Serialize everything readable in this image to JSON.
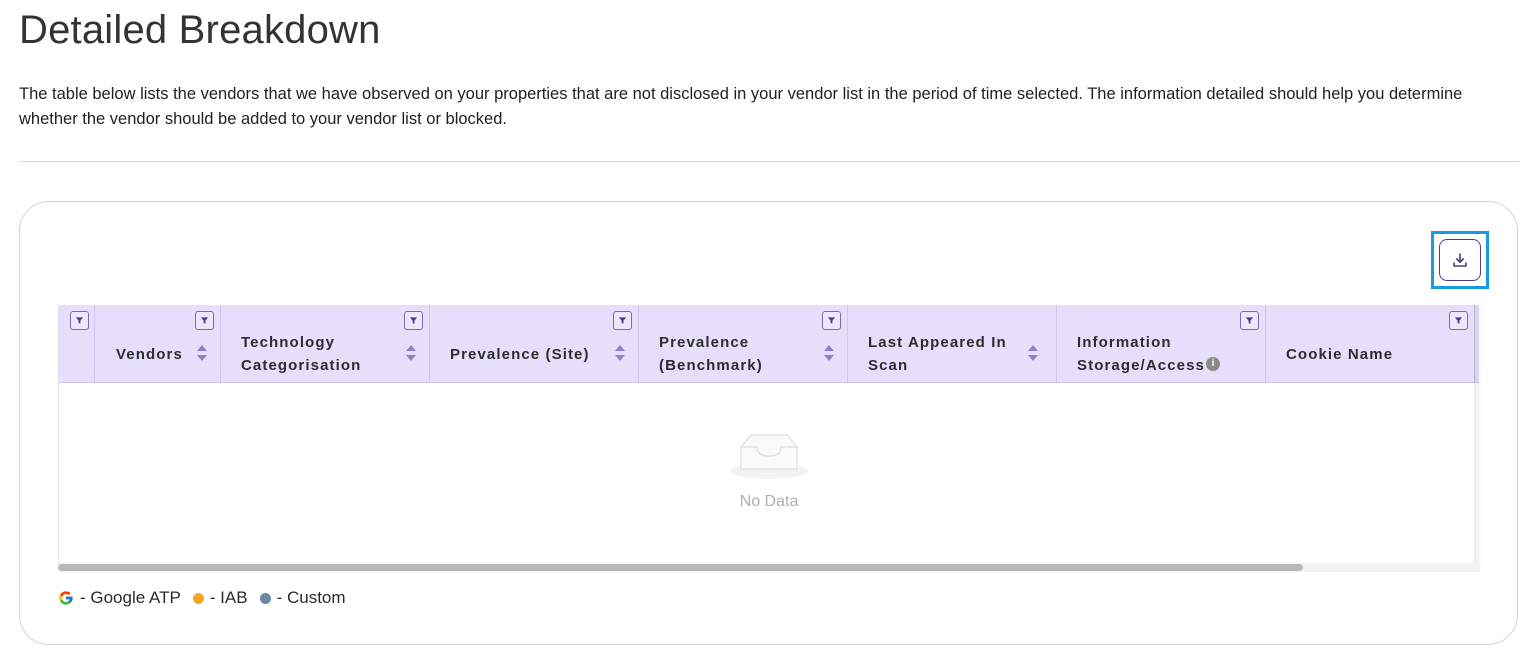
{
  "page": {
    "title": "Detailed Breakdown",
    "description": "The table below lists the vendors that we have observed on your properties that are not disclosed in your vendor list in the period of time selected. The information detailed should help you determine whether the vendor should be added to your vendor list or blocked."
  },
  "table": {
    "columns": [
      {
        "label": "Vendors"
      },
      {
        "label": "Technology Categorisation"
      },
      {
        "label": "Prevalence (Site)"
      },
      {
        "label": "Prevalence (Benchmark)"
      },
      {
        "label": "Last Appeared In Scan"
      },
      {
        "label": "Information Storage/Access"
      },
      {
        "label": "Cookie Name"
      }
    ],
    "empty_text": "No Data"
  },
  "legend": {
    "items": [
      {
        "icon": "google-icon",
        "label": "- Google ATP"
      },
      {
        "icon": "orange-dot",
        "label": "- IAB",
        "color": "#f5a623"
      },
      {
        "icon": "slate-dot",
        "label": "- Custom",
        "color": "#6f86a8"
      }
    ]
  },
  "colors": {
    "header_bg": "#e6dffb",
    "accent": "#4b3c8f",
    "highlight": "#1a9be6"
  }
}
